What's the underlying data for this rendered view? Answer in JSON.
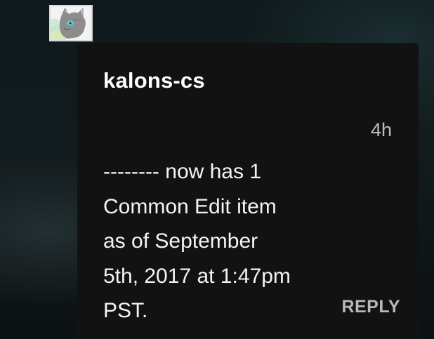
{
  "comment": {
    "username": "kalons-cs",
    "timestamp": "4h",
    "message": "-------- now has 1\nCommon Edit item\nas of September\n5th, 2017 at 1:47pm\nPST.",
    "reply_label": "REPLY",
    "avatar_icon": "cat-avatar-icon"
  },
  "colors": {
    "card_background": "#121212",
    "page_background": "#0d1416",
    "text_primary": "#ffffff",
    "text_secondary": "#bdbdbd"
  }
}
